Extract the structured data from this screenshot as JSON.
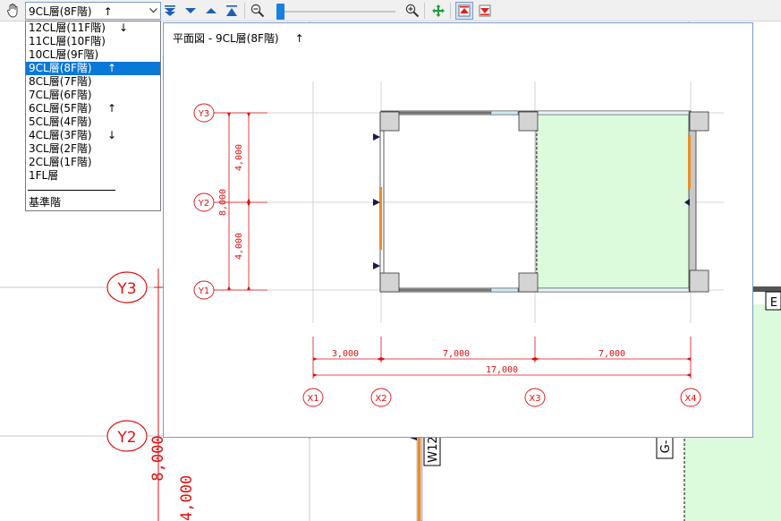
{
  "toolbar": {
    "floor_select_value": "9CL層(8F階)",
    "floor_select_arrow": "↑",
    "icons": [
      "hand-icon",
      "chevron-down-icon",
      "go-bottom-icon",
      "step-down-icon",
      "step-up-icon",
      "go-top-icon",
      "zoom-out-icon",
      "zoom-in-icon",
      "pan-icon",
      "upper-floor-icon",
      "lower-floor-icon"
    ],
    "zoom_level": 0.0
  },
  "dropdown": {
    "items": [
      {
        "label": "12CL層(11F階)",
        "arrow": "↓"
      },
      {
        "label": "11CL層(10F階)",
        "arrow": ""
      },
      {
        "label": "10CL層(9F階)",
        "arrow": ""
      },
      {
        "label": "9CL層(8F階)",
        "arrow": "↑",
        "selected": true
      },
      {
        "label": "8CL層(7F階)",
        "arrow": ""
      },
      {
        "label": "7CL層(6F階)",
        "arrow": ""
      },
      {
        "label": "6CL層(5F階)",
        "arrow": "↑"
      },
      {
        "label": "5CL層(4F階)",
        "arrow": ""
      },
      {
        "label": "4CL層(3F階)",
        "arrow": "↓"
      },
      {
        "label": "3CL層(2F階)",
        "arrow": ""
      },
      {
        "label": "2CL層(1F階)",
        "arrow": ""
      },
      {
        "label": "1FL層",
        "arrow": ""
      }
    ],
    "base_label": "基準階"
  },
  "popup": {
    "title": "平面図 - 9CL層(8F階)",
    "title_arrow": "↑",
    "grid_y": [
      "Y3",
      "Y2",
      "Y1"
    ],
    "grid_x": [
      "X1",
      "X2",
      "X3",
      "X4"
    ],
    "dim_vertical": [
      "4,000",
      "4,000"
    ],
    "dim_vertical_total": "8,000",
    "dim_horizontal": [
      "3,000",
      "7,000",
      "7,000"
    ],
    "dim_horizontal_total": "17,000"
  },
  "background": {
    "grid_y": [
      "Y3",
      "Y2"
    ],
    "dim_vertical": [
      "8,000",
      "4,000"
    ],
    "wall_label": "W12",
    "beam_label": "G-",
    "edge_label": "E"
  },
  "colors": {
    "grid_red": "#e01010",
    "selection_blue": "#0a78d7",
    "room_green": "#dcfadc",
    "opening_orange": "#f08a24",
    "column_gray": "#d4d4d4"
  }
}
